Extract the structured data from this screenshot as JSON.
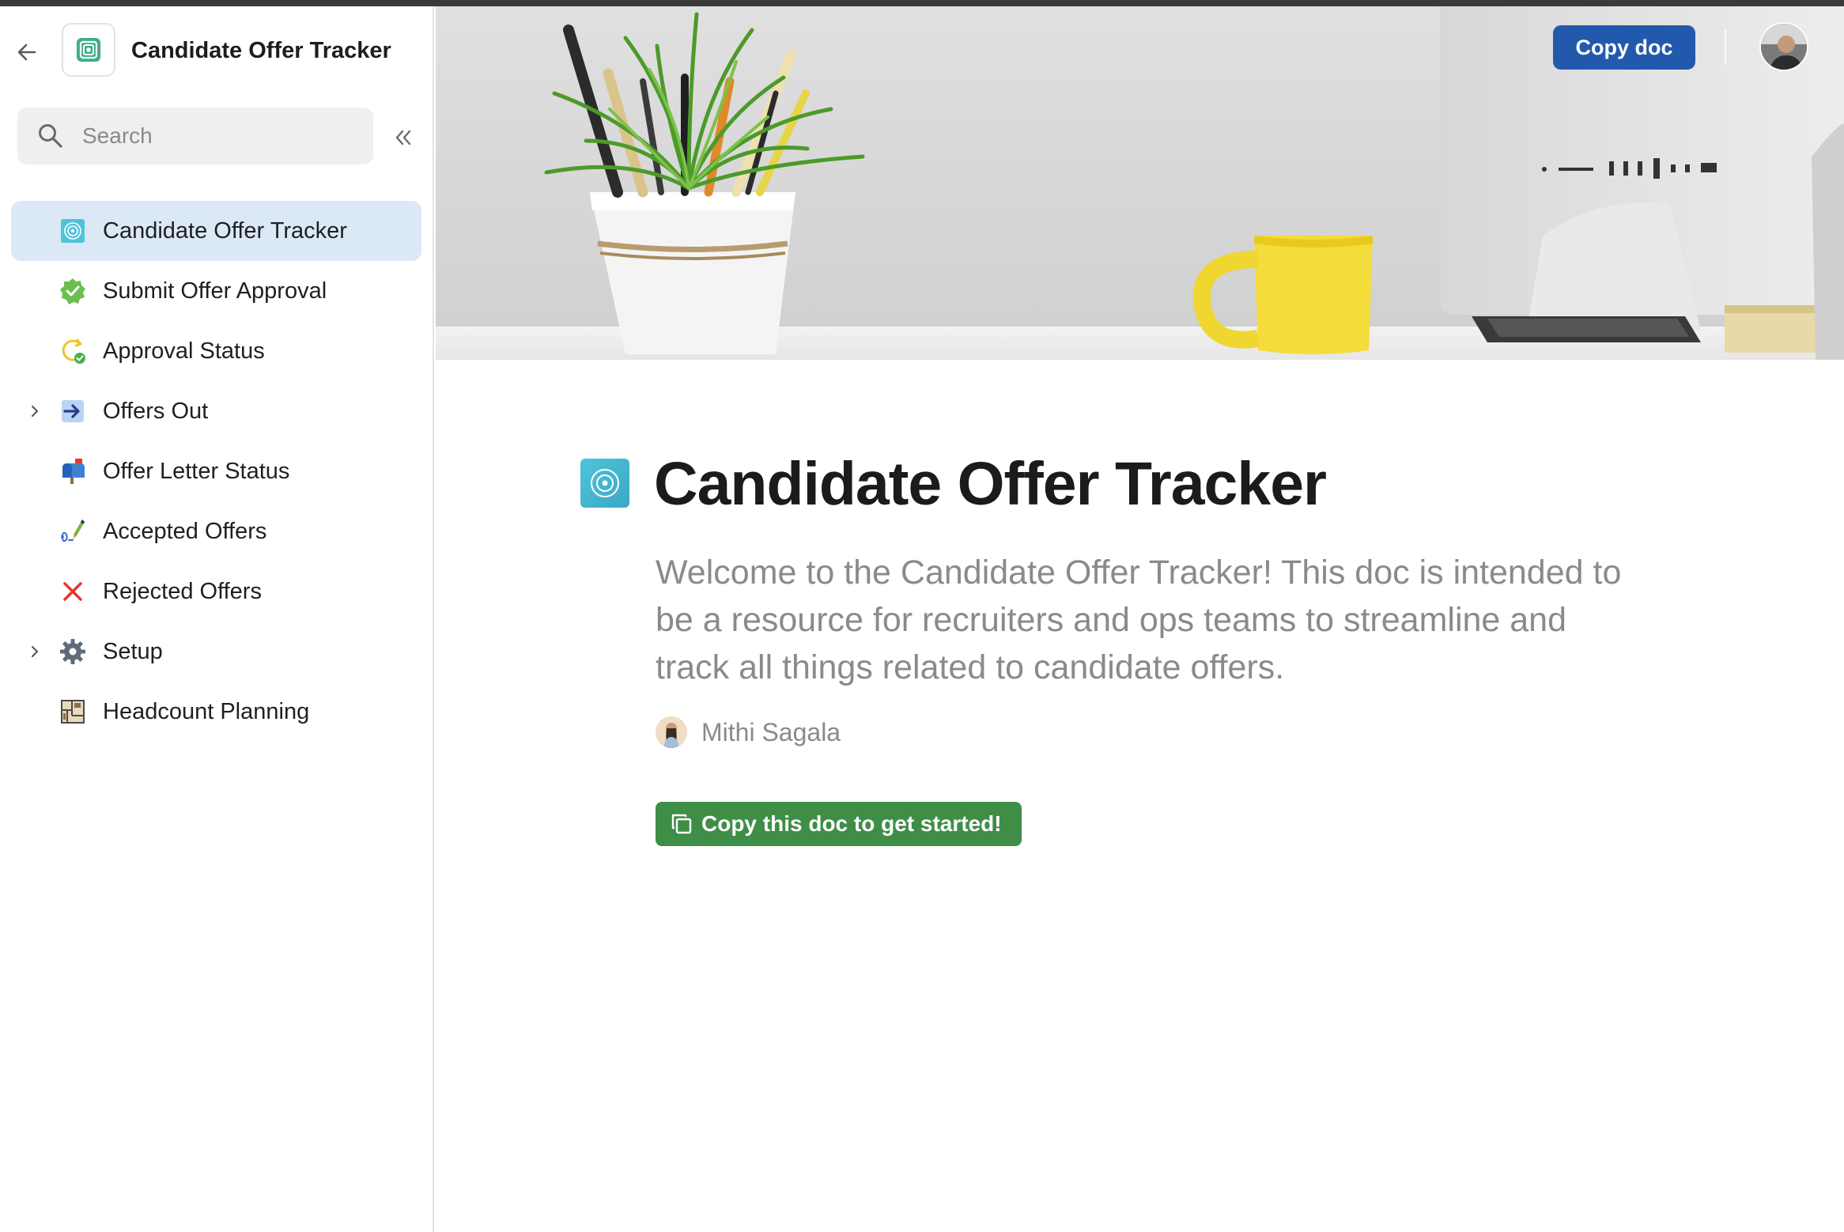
{
  "sidebar": {
    "doc_title": "Candidate Offer Tracker",
    "search": {
      "placeholder": "Search",
      "value": ""
    },
    "items": [
      {
        "label": "Candidate Offer Tracker",
        "icon": "target-icon",
        "active": true,
        "expandable": false
      },
      {
        "label": "Submit Offer Approval",
        "icon": "verified-badge-icon",
        "active": false,
        "expandable": false
      },
      {
        "label": "Approval Status",
        "icon": "refresh-check-icon",
        "active": false,
        "expandable": false
      },
      {
        "label": "Offers Out",
        "icon": "arrow-right-box-icon",
        "active": false,
        "expandable": true
      },
      {
        "label": "Offer Letter Status",
        "icon": "mailbox-icon",
        "active": false,
        "expandable": false
      },
      {
        "label": "Accepted Offers",
        "icon": "signature-pen-icon",
        "active": false,
        "expandable": false
      },
      {
        "label": "Rejected Offers",
        "icon": "red-x-icon",
        "active": false,
        "expandable": false
      },
      {
        "label": "Setup",
        "icon": "gear-icon",
        "active": false,
        "expandable": true
      },
      {
        "label": "Headcount Planning",
        "icon": "floor-plan-icon",
        "active": false,
        "expandable": false
      }
    ]
  },
  "header": {
    "copy_doc_label": "Copy doc"
  },
  "page": {
    "title": "Candidate Offer Tracker",
    "subtitle": "Welcome to the Candidate Offer Tracker! This doc is intended to be a resource for recruiters and ops teams to streamline and track all things related to candidate offers.",
    "author": "Mithi Sagala",
    "cta_label": "Copy this doc to get started!"
  },
  "colors": {
    "active_nav_bg": "#dbe9f7",
    "copy_doc_button": "#2359ad",
    "cta_button": "#3e8e47",
    "subtitle_text": "#8a8a8a",
    "page_icon": "#4fc4d9"
  }
}
